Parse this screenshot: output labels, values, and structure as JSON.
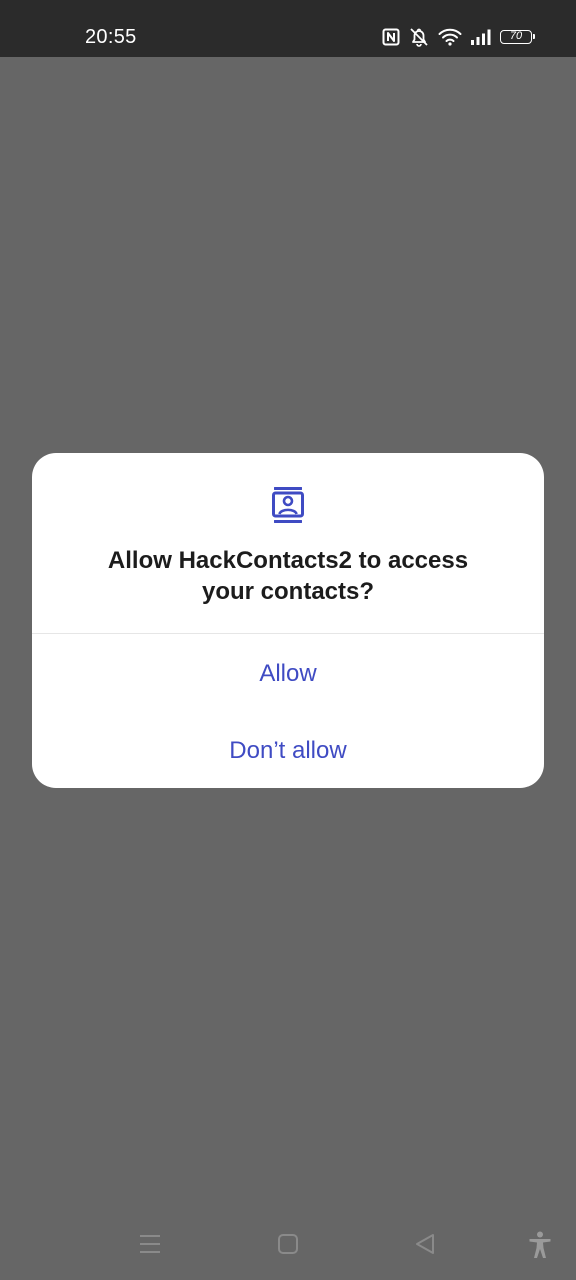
{
  "status_bar": {
    "time": "20:55",
    "battery_level": "70",
    "icons": [
      "nfc-icon",
      "bell-muted-icon",
      "wifi-icon",
      "signal-icon",
      "battery-icon"
    ]
  },
  "dialog": {
    "icon": "contacts-icon",
    "title_line1": "Allow HackContacts2 to access",
    "title_line2": "your contacts?",
    "allow_label": "Allow",
    "deny_label": "Don’t allow"
  },
  "nav_bar": {
    "icons": [
      "menu-icon",
      "home-icon",
      "back-icon",
      "accessibility-icon"
    ]
  },
  "colors": {
    "accent": "#3f4bc3",
    "scrim": "#666666",
    "status_bar": "#2b2b2b",
    "dialog_bg": "#ffffff"
  }
}
